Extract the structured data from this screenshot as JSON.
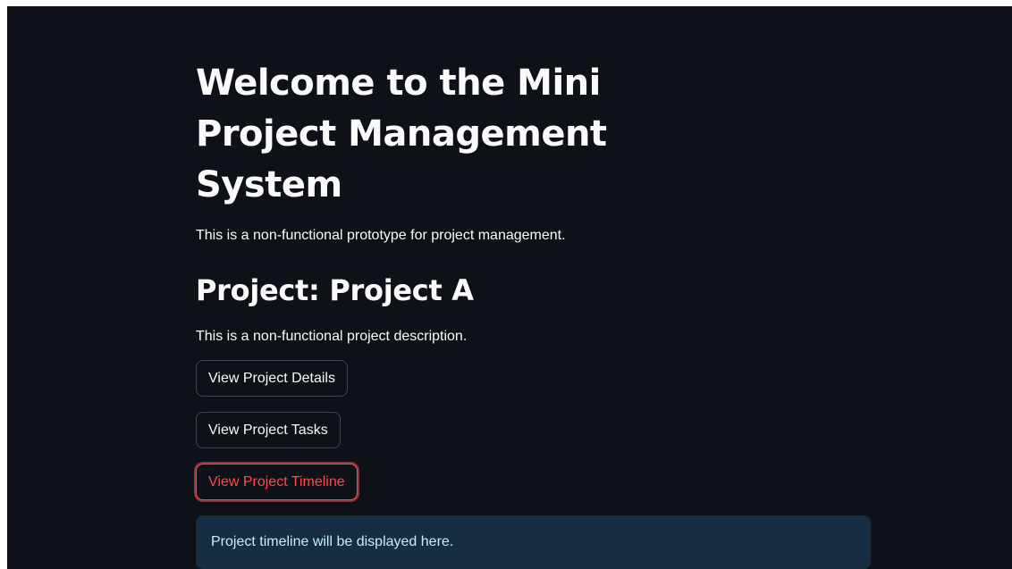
{
  "page": {
    "title": "Welcome to the Mini Project Management System",
    "subtitle": "This is a non-functional prototype for project management."
  },
  "project": {
    "heading": "Project: Project A",
    "description": "This is a non-functional project description."
  },
  "buttons": {
    "details_label": "View Project Details",
    "tasks_label": "View Project Tasks",
    "timeline_label": "View Project Timeline"
  },
  "info": {
    "message": "Project timeline will be displayed here."
  },
  "colors": {
    "background": "#0e1117",
    "text": "#fafafa",
    "accent": "#ff4b4b",
    "info_background": "#172d43",
    "info_text": "#c7ebff"
  }
}
